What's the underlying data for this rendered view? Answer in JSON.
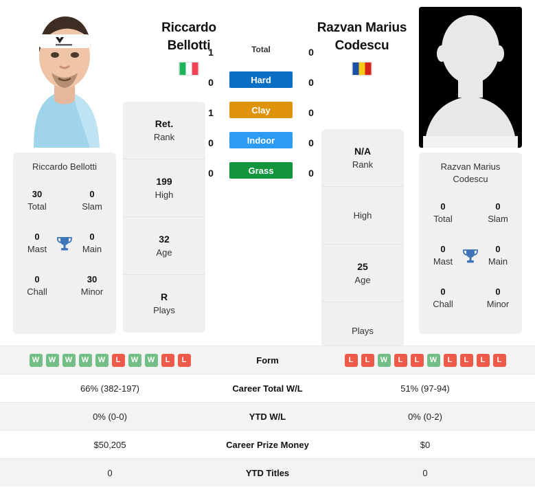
{
  "players": {
    "left": {
      "name_line1": "Riccardo",
      "name_line2": "Bellotti",
      "full_name": "Riccardo Bellotti",
      "flag": "italy-flag",
      "photo": "player-photo",
      "rank": "Ret.",
      "rank_label": "Rank",
      "high": "199",
      "high_label": "High",
      "age": "32",
      "age_label": "Age",
      "plays": "R",
      "plays_label": "Plays",
      "titles": {
        "total": "30",
        "total_label": "Total",
        "slam": "0",
        "slam_label": "Slam",
        "mast": "0",
        "mast_label": "Mast",
        "main": "0",
        "main_label": "Main",
        "chall": "0",
        "chall_label": "Chall",
        "minor": "30",
        "minor_label": "Minor"
      }
    },
    "right": {
      "name_line1": "Razvan Marius",
      "name_line2": "Codescu",
      "full_name_line1": "Razvan Marius",
      "full_name_line2": "Codescu",
      "flag": "romania-flag",
      "photo": "player-photo-placeholder",
      "rank": "N/A",
      "rank_label": "Rank",
      "high": "",
      "high_label": "High",
      "age": "25",
      "age_label": "Age",
      "plays": "",
      "plays_label": "Plays",
      "titles": {
        "total": "0",
        "total_label": "Total",
        "slam": "0",
        "slam_label": "Slam",
        "mast": "0",
        "mast_label": "Mast",
        "main": "0",
        "main_label": "Main",
        "chall": "0",
        "chall_label": "Chall",
        "minor": "0",
        "minor_label": "Minor"
      }
    }
  },
  "head_to_head": {
    "rows": [
      {
        "label": "Total",
        "left": "1",
        "right": "0",
        "color": "",
        "style": "plain"
      },
      {
        "label": "Hard",
        "left": "0",
        "right": "0",
        "color": "#0b6fc4",
        "style": "bar"
      },
      {
        "label": "Clay",
        "left": "1",
        "right": "0",
        "color": "#e0930d",
        "style": "bar"
      },
      {
        "label": "Indoor",
        "left": "0",
        "right": "0",
        "color": "#2b9bf4",
        "style": "bar"
      },
      {
        "label": "Grass",
        "left": "0",
        "right": "0",
        "color": "#12953d",
        "style": "bar"
      }
    ]
  },
  "comparison": {
    "rows": [
      {
        "label": "Form",
        "type": "form",
        "left_form": [
          "W",
          "W",
          "W",
          "W",
          "W",
          "L",
          "W",
          "W",
          "L",
          "L"
        ],
        "right_form": [
          "L",
          "L",
          "W",
          "L",
          "L",
          "W",
          "L",
          "L",
          "L",
          "L"
        ]
      },
      {
        "label": "Career Total W/L",
        "type": "text",
        "left": "66% (382-197)",
        "right": "51% (97-94)"
      },
      {
        "label": "YTD W/L",
        "type": "text",
        "left": "0% (0-0)",
        "right": "0% (0-2)"
      },
      {
        "label": "Career Prize Money",
        "type": "text",
        "left": "$50,205",
        "right": "$0"
      },
      {
        "label": "YTD Titles",
        "type": "text",
        "left": "0",
        "right": "0"
      }
    ]
  },
  "colors": {
    "win_badge": "#73bd86",
    "loss_badge": "#ef5b48",
    "panel_bg": "#f0f0f0",
    "trophy": "#3d75b8"
  }
}
